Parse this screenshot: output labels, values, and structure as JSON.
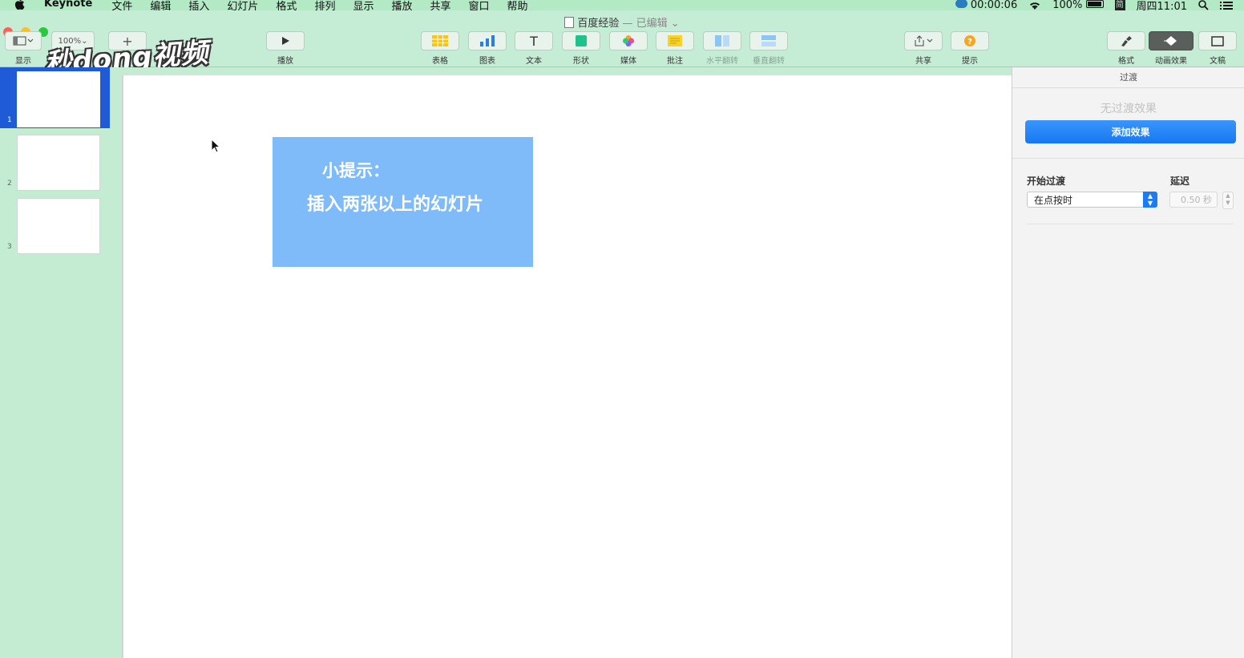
{
  "menubar": {
    "app_name": "Keynote",
    "menus": [
      "文件",
      "编辑",
      "插入",
      "幻灯片",
      "格式",
      "排列",
      "显示",
      "播放",
      "共享",
      "窗口",
      "帮助"
    ],
    "recording_time": "00:00:06",
    "battery": "100%",
    "ime": "简",
    "clock": "周四11:01"
  },
  "window": {
    "title": "百度经验",
    "separator": " — ",
    "status": "已编辑"
  },
  "toolbar": {
    "view_label": "显示",
    "zoom_value": "100%",
    "play_label": "播放",
    "table_label": "表格",
    "chart_label": "图表",
    "text_label": "文本",
    "shape_label": "形状",
    "media_label": "媒体",
    "comment_label": "批注",
    "flip_h_label": "水平翻转",
    "flip_v_label": "垂直翻转",
    "share_label": "共享",
    "tips_label": "提示",
    "format_label": "格式",
    "animate_label": "动画效果",
    "document_label": "文稿"
  },
  "watermark": "秒dong视频",
  "slides": [
    {
      "number": "1",
      "selected": true
    },
    {
      "number": "2",
      "selected": false
    },
    {
      "number": "3",
      "selected": false
    }
  ],
  "slide_content": {
    "tip_title": "小提示：",
    "tip_text": "插入两张以上的幻灯片"
  },
  "inspector": {
    "tab": "过渡",
    "no_effect": "无过渡效果",
    "add_effect_button": "添加效果",
    "start_transition_label": "开始过渡",
    "start_transition_value": "在点按时",
    "delay_label": "延迟",
    "delay_value": "0.50 秒"
  },
  "colors": {
    "selection": "#1f5bd7",
    "tip_box": "#7fbbf9",
    "accent_button": "#1677f2"
  }
}
